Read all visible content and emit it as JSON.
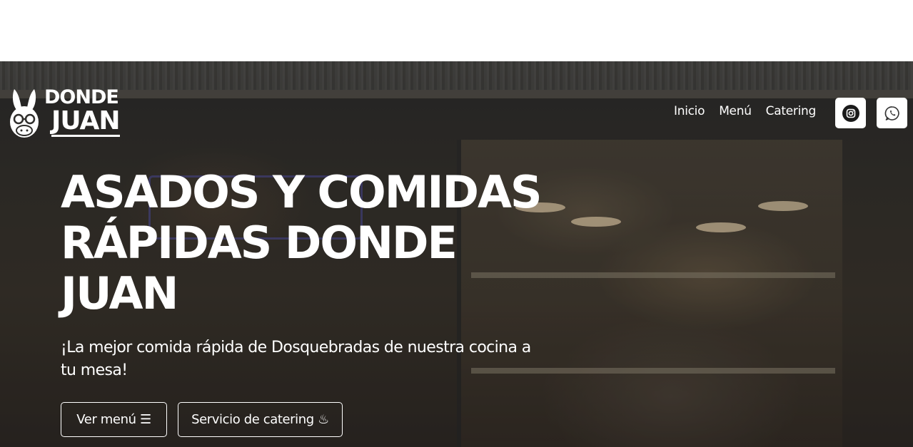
{
  "brand": {
    "line1": "DONDE",
    "line2": "JUAN"
  },
  "nav": {
    "items": [
      {
        "label": "Inicio"
      },
      {
        "label": "Menú"
      },
      {
        "label": "Catering"
      }
    ]
  },
  "social": {
    "instagram_icon": "instagram-icon",
    "whatsapp_icon": "whatsapp-icon"
  },
  "hero": {
    "headline_line1": "ASADOS Y COMIDAS",
    "headline_line2": "RÁPIDAS DONDE",
    "headline_line3": "JUAN",
    "subtitle": "¡La mejor comida rápida de Dosquebradas de nuestra cocina a tu mesa!",
    "buttons": {
      "menu_label": "Ver menú",
      "menu_icon": "☰",
      "catering_label": "Servicio de catering",
      "catering_icon": "♨"
    }
  },
  "colors": {
    "text": "#ffffff",
    "background_top": "#ffffff",
    "button_border": "#ffffff",
    "social_bg": "#ffffff",
    "social_icon": "#1a1a1a"
  }
}
